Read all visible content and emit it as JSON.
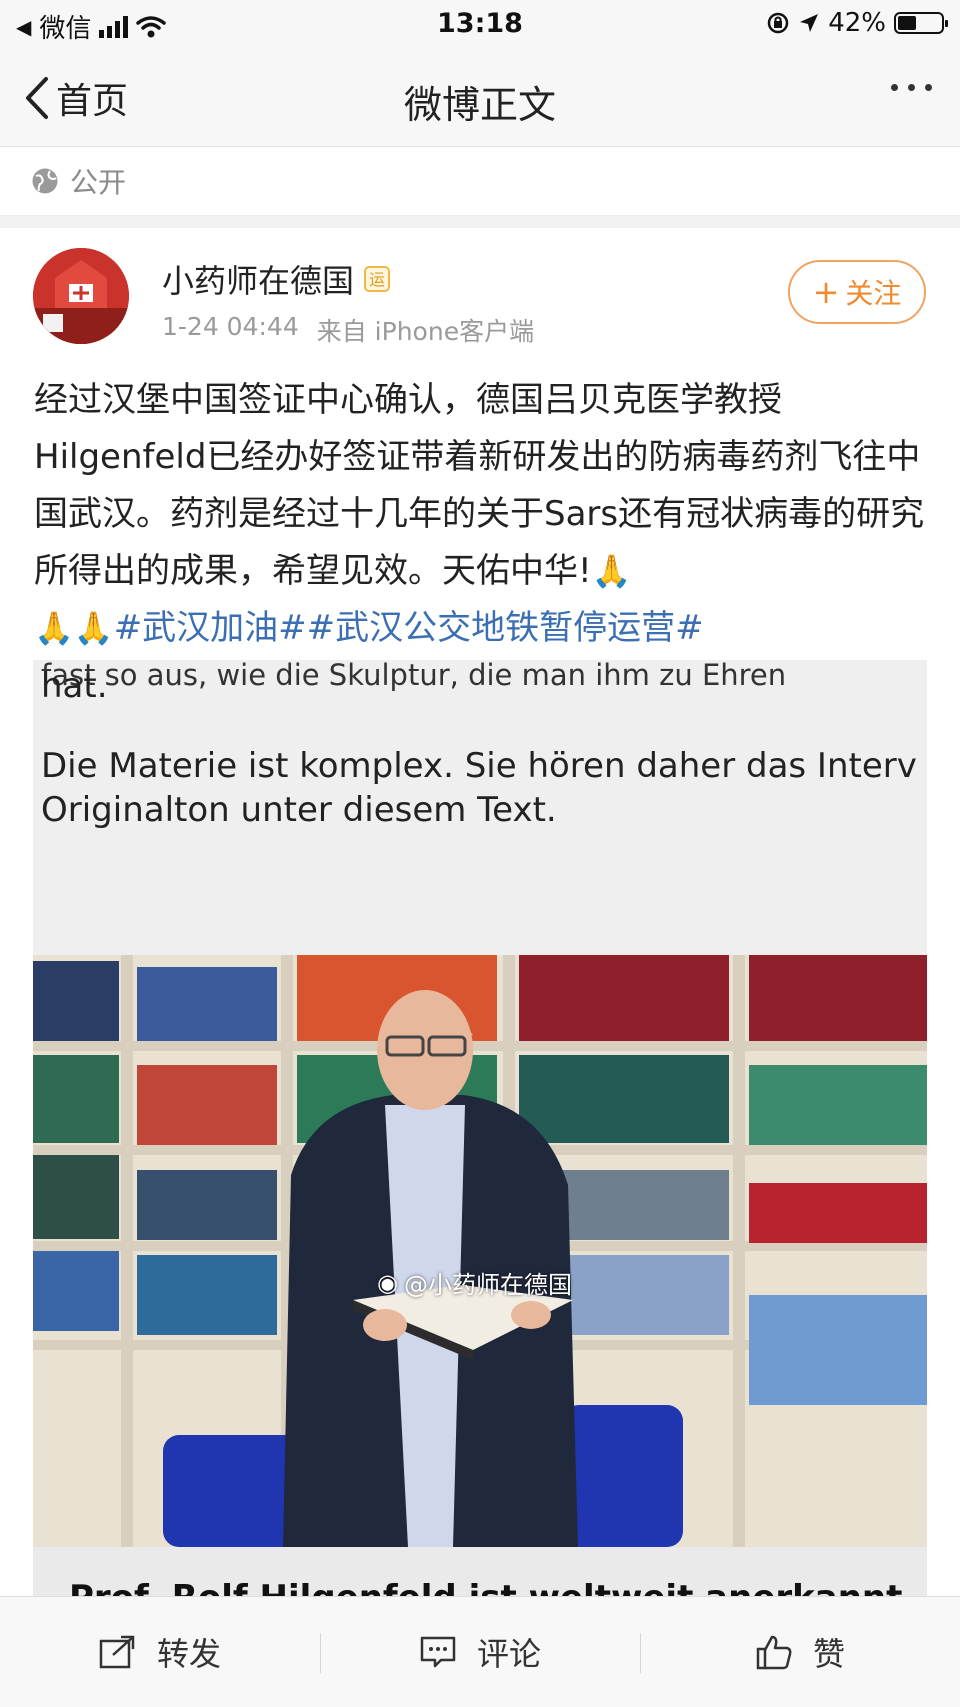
{
  "status_bar": {
    "carrier": "微信",
    "time": "13:18",
    "battery_percent": "42%",
    "battery_level": 0.42
  },
  "nav": {
    "back_label": "首页",
    "title": "微博正文"
  },
  "visibility": {
    "label": "公开"
  },
  "post": {
    "author": "小药师在德国",
    "badge": "运",
    "time": "1-24 04:44",
    "source": "来自 iPhone客户端",
    "follow_label": "关注",
    "text_main": "经过汉堡中国签证中心确认，德国吕贝克医学教授Hilgenfeld已经办好签证带着新研发出的防病毒药剂飞往中国武汉。药剂是经过十几年的关于Sars还有冠状病毒的研究所得出的成果，希望见效。天佑中华!",
    "tag1": "#武汉加油#",
    "tag2": "#武汉公交地铁暂停运营#",
    "emoji_count": 3
  },
  "image": {
    "cut_line": "fast so aus, wie die Skulptur, die man ihm zu Ehren",
    "line1": "hat.",
    "line2": "Die Materie ist komplex. Sie hören daher das Interv",
    "line3": "Originalton unter diesem Text.",
    "watermark": "@小药师在德国",
    "bottom_caption": "Prof. Rolf Hilgenfeld ist weltweit anerkannt"
  },
  "actions": {
    "repost": "转发",
    "comment": "评论",
    "like": "赞"
  },
  "colors": {
    "link": "#3b6eb3",
    "follow": "#ef8a2f",
    "meta": "#9a9a9a"
  }
}
